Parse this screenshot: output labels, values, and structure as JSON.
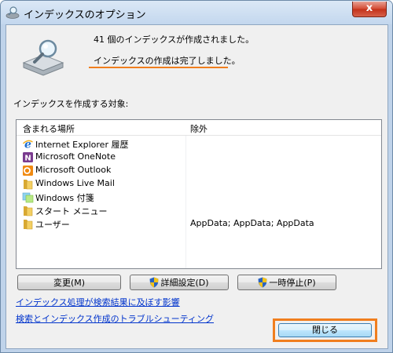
{
  "window": {
    "title": "インデックスのオプション",
    "close_glyph": "x"
  },
  "status": {
    "count_text": "41 個のインデックスが作成されました。",
    "complete_text": "インデックスの作成は完了しました。"
  },
  "locations": {
    "label": "インデックスを作成する対象:",
    "header": {
      "included": "含まれる場所",
      "excluded": "除外"
    },
    "rows": [
      {
        "name": "Internet Explorer 履歴",
        "excluded": "",
        "icon": "ie-icon"
      },
      {
        "name": "Microsoft OneNote",
        "excluded": "",
        "icon": "onenote-icon"
      },
      {
        "name": "Microsoft Outlook",
        "excluded": "",
        "icon": "outlook-icon"
      },
      {
        "name": "Windows Live Mail",
        "excluded": "",
        "icon": "folder-icon"
      },
      {
        "name": "Windows 付箋",
        "excluded": "",
        "icon": "sticky-notes-icon"
      },
      {
        "name": "スタート メニュー",
        "excluded": "",
        "icon": "folder-icon"
      },
      {
        "name": "ユーザー",
        "excluded": "AppData; AppData; AppData",
        "icon": "folder-icon"
      }
    ]
  },
  "buttons": {
    "modify": "変更(M)",
    "advanced": "詳細設定(D)",
    "pause": "一時停止(P)",
    "close": "閉じる"
  },
  "links": {
    "affect_search": "インデックス処理が検索結果に及ぼす影響",
    "troubleshoot": "検索とインデックス作成のトラブルシューティング"
  },
  "colors": {
    "highlight": "#f07e1e",
    "link": "#0033cc"
  }
}
